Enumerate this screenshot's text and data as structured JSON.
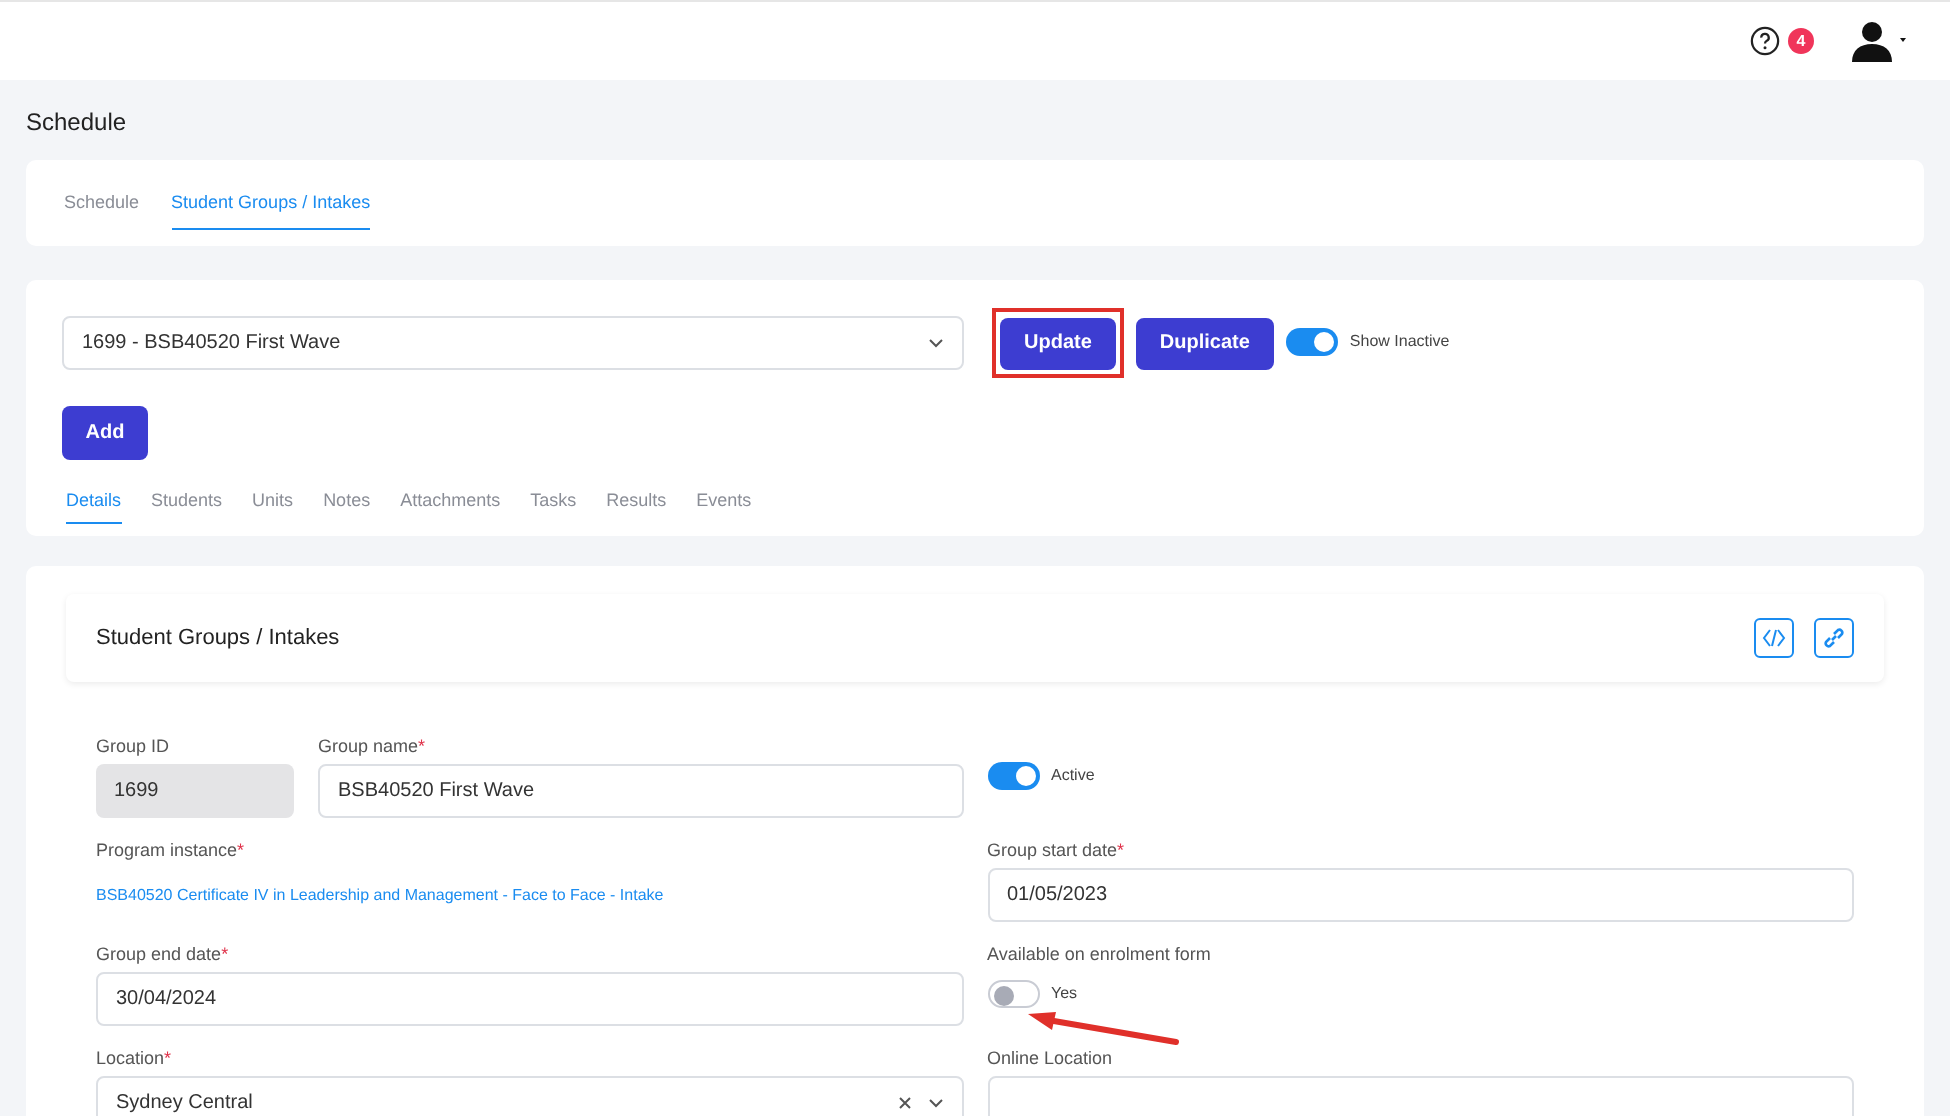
{
  "header": {
    "notification_count": "4"
  },
  "page_title": "Schedule",
  "top_tabs": [
    {
      "label": "Schedule",
      "selected": false
    },
    {
      "label": "Student Groups / Intakes",
      "selected": true
    }
  ],
  "group_select": {
    "value": "1699 - BSB40520 First Wave"
  },
  "actions": [
    {
      "label": "Update",
      "highlighted": true
    },
    {
      "label": "Duplicate",
      "highlighted": false
    }
  ],
  "show_inactive": {
    "label": "Show Inactive",
    "on": true
  },
  "add_button": "Add",
  "detail_tabs": [
    {
      "label": "Details",
      "selected": true
    },
    {
      "label": "Students",
      "selected": false
    },
    {
      "label": "Units",
      "selected": false
    },
    {
      "label": "Notes",
      "selected": false
    },
    {
      "label": "Attachments",
      "selected": false
    },
    {
      "label": "Tasks",
      "selected": false
    },
    {
      "label": "Results",
      "selected": false
    },
    {
      "label": "Events",
      "selected": false
    }
  ],
  "panel": {
    "title": "Student Groups / Intakes"
  },
  "form": {
    "group_id": {
      "label": "Group ID",
      "value": "1699"
    },
    "group_name": {
      "label": "Group name",
      "required_mark": "*",
      "value": "BSB40520 First Wave"
    },
    "active": {
      "label": "Active",
      "on": true
    },
    "program_instance": {
      "label": "Program instance",
      "required_mark": "*",
      "value": "BSB40520 Certificate IV in Leadership and Management - Face to Face - Intake"
    },
    "group_start_date": {
      "label": "Group start date",
      "required_mark": "*",
      "value": "01/05/2023"
    },
    "group_end_date": {
      "label": "Group end date",
      "required_mark": "*",
      "value": "30/04/2024"
    },
    "enrolment": {
      "label": "Available on enrolment form",
      "toggle_label": "Yes",
      "on": false
    },
    "location": {
      "label": "Location",
      "required_mark": "*",
      "value": "Sydney Central"
    },
    "online_location": {
      "label": "Online Location"
    }
  }
}
